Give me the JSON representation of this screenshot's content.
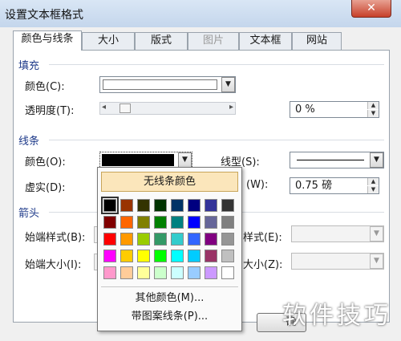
{
  "window": {
    "title": "设置文本框格式",
    "close": "✕"
  },
  "tabs": [
    {
      "label": "颜色与线条"
    },
    {
      "label": "大小"
    },
    {
      "label": "版式"
    },
    {
      "label": "图片"
    },
    {
      "label": "文本框"
    },
    {
      "label": "网站"
    }
  ],
  "fill": {
    "section": "填充",
    "color_label": "颜色(C):",
    "transparency_label": "透明度(T):",
    "transparency_value": "0 %",
    "slider_left": "◂",
    "slider_right": "▸"
  },
  "line": {
    "section": "线条",
    "color_label": "颜色(O):",
    "style_label": "线型(S):",
    "dash_label": "虚实(D):",
    "weight_label_tail": "(W):",
    "weight_value": "0.75 磅"
  },
  "arrows": {
    "section": "箭头",
    "begin_style_label": "始端样式(B):",
    "end_style_label_tail": "样式(E):",
    "begin_size_label": "始端大小(I):",
    "end_size_label_tail": "大小(Z):"
  },
  "popup": {
    "no_line": "无线条颜色",
    "more_colors": "其他颜色(M)...",
    "patterned": "带图案线条(P)...",
    "palette": [
      [
        "#000000",
        "#993300",
        "#333300",
        "#003300",
        "#003366",
        "#000080",
        "#333399",
        "#333333"
      ],
      [
        "#800000",
        "#ff6600",
        "#808000",
        "#008000",
        "#008080",
        "#0000ff",
        "#666699",
        "#808080"
      ],
      [
        "#ff0000",
        "#ff9900",
        "#99cc00",
        "#339966",
        "#33cccc",
        "#3366ff",
        "#800080",
        "#969696"
      ],
      [
        "#ff00ff",
        "#ffcc00",
        "#ffff00",
        "#00ff00",
        "#00ffff",
        "#00ccff",
        "#993366",
        "#c0c0c0"
      ],
      [
        "#ff99cc",
        "#ffcc99",
        "#ffff99",
        "#ccffcc",
        "#ccffff",
        "#99ccff",
        "#cc99ff",
        "#ffffff"
      ]
    ]
  },
  "ok_partial": "确",
  "watermark": "软件技巧",
  "icons": {
    "dropdown": "▼",
    "spin_up": "▲",
    "spin_down": "▼"
  }
}
